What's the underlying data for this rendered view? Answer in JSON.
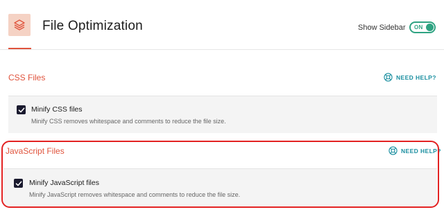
{
  "header": {
    "title": "File Optimization",
    "icon": "layers-icon",
    "show_sidebar_label": "Show Sidebar",
    "toggle_state": "ON"
  },
  "sections": [
    {
      "title": "CSS Files",
      "help_label": "NEED HELP?",
      "option": {
        "label": "Minify CSS files",
        "description": "Minify CSS removes whitespace and comments to reduce the file size.",
        "checked": true
      }
    },
    {
      "title": "JavaScript Files",
      "help_label": "NEED HELP?",
      "option": {
        "label": "Minify JavaScript files",
        "description": "Minify JavaScript removes whitespace and comments to reduce the file size.",
        "checked": true
      }
    }
  ],
  "colors": {
    "accent": "#e0533c",
    "toggle": "#2fa382",
    "help": "#1b8fa0",
    "highlight": "#e32222"
  }
}
